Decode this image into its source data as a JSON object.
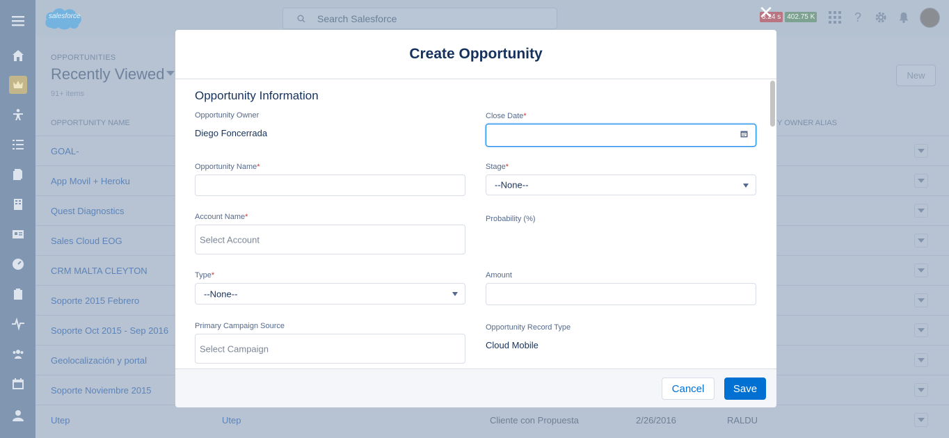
{
  "app": {
    "logo_text": "salesforce",
    "search_placeholder": "Search Salesforce",
    "badges": {
      "time": "3.24 s",
      "size": "402.75 K"
    }
  },
  "list": {
    "object_label": "OPPORTUNITIES",
    "title": "Recently Viewed",
    "count": "91+ items",
    "new_label": "New",
    "col_name": "OPPORTUNITY NAME",
    "col_alias": "Y OWNER ALIAS",
    "rows": [
      {
        "name": "GOAL-",
        "account": "",
        "stage": "",
        "date": "",
        "alias": ""
      },
      {
        "name": "App Movil + Heroku",
        "account": "",
        "stage": "",
        "date": "",
        "alias": ""
      },
      {
        "name": "Quest Diagnostics",
        "account": "",
        "stage": "",
        "date": "",
        "alias": ""
      },
      {
        "name": "Sales Cloud EOG",
        "account": "",
        "stage": "",
        "date": "",
        "alias": ""
      },
      {
        "name": "CRM MALTA CLEYTON",
        "account": "",
        "stage": "",
        "date": "",
        "alias": ""
      },
      {
        "name": "Soporte 2015 Febrero",
        "account": "",
        "stage": "",
        "date": "",
        "alias": ""
      },
      {
        "name": "Soporte Oct 2015 - Sep 2016",
        "account": "",
        "stage": "",
        "date": "",
        "alias": ""
      },
      {
        "name": "Geolocalización y portal",
        "account": "",
        "stage": "",
        "date": "",
        "alias": ""
      },
      {
        "name": "Soporte Noviembre 2015",
        "account": "",
        "stage": "",
        "date": "",
        "alias": ""
      },
      {
        "name": "Utep",
        "account": "Utep",
        "stage": "Cliente con Propuesta",
        "date": "2/26/2016",
        "alias": "RALDU"
      }
    ]
  },
  "modal": {
    "title": "Create Opportunity",
    "section": "Opportunity Information",
    "owner_label": "Opportunity Owner",
    "owner_value": "Diego Foncerrada",
    "close_date_label": "Close Date",
    "close_date_value": "",
    "name_label": "Opportunity Name",
    "name_value": "",
    "stage_label": "Stage",
    "stage_value": "--None--",
    "account_label": "Account Name",
    "account_placeholder": "Select Account",
    "probability_label": "Probability (%)",
    "type_label": "Type",
    "type_value": "--None--",
    "amount_label": "Amount",
    "amount_value": "",
    "campaign_label": "Primary Campaign Source",
    "campaign_placeholder": "Select Campaign",
    "record_type_label": "Opportunity Record Type",
    "record_type_value": "Cloud Mobile",
    "required_mark": "*",
    "cancel_label": "Cancel",
    "save_label": "Save"
  },
  "colors": {
    "brand": "#0070d2",
    "required": "#c23934",
    "text": "#16325c"
  }
}
